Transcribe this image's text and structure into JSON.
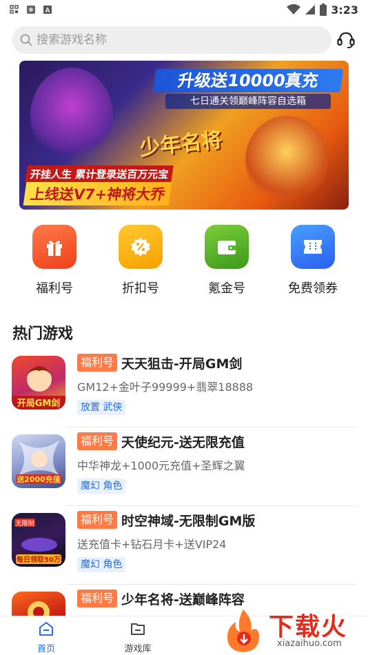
{
  "status_bar": {
    "time": "3:23"
  },
  "search": {
    "placeholder": "搜索游戏名称"
  },
  "banner": {
    "headline": "升级送10000真充",
    "subline": "七日通关领巅峰阵容自选箱",
    "logo_text": "少年名将",
    "line1": "开挂人生  累计登录送百万元宝",
    "line2": "上线送V7+神将大乔"
  },
  "quick_entries": [
    {
      "label": "福利号",
      "icon": "gift-icon",
      "color_from": "#ff7a4a",
      "color_to": "#f0401a"
    },
    {
      "label": "折扣号",
      "icon": "discount-icon",
      "color_from": "#ffc830",
      "color_to": "#f7a000"
    },
    {
      "label": "氪金号",
      "icon": "wallet-icon",
      "color_from": "#7ccd3a",
      "color_to": "#3a9a1a"
    },
    {
      "label": "免费领券",
      "icon": "coupon-icon",
      "color_from": "#4aa0ff",
      "color_to": "#2a5ef0"
    }
  ],
  "section": {
    "hot_games_title": "热门游戏"
  },
  "games": [
    {
      "tag": "福利号",
      "name": "天天狙击-开局GM剑",
      "desc": "GM12+金叶子99999+翡翠18888",
      "category": "放置 武侠"
    },
    {
      "tag": "福利号",
      "name": "天使纪元-送无限充值",
      "desc": "中华神龙+1000元充值+圣辉之翼",
      "category": "魔幻 角色"
    },
    {
      "tag": "福利号",
      "name": "时空神域-无限制GM版",
      "desc": "送充值卡+钻石月卡+送VIP24",
      "category": "魔幻 角色"
    },
    {
      "tag": "福利号",
      "name": "少年名将-送巅峰阵容",
      "desc": "",
      "category": ""
    }
  ],
  "bottom_nav": [
    {
      "label": "首页",
      "icon": "home-icon",
      "active": true
    },
    {
      "label": "游戏库",
      "icon": "folder-icon",
      "active": false
    }
  ],
  "watermark": {
    "brand": "下载火",
    "url": "xiazaihuo.com"
  },
  "colors": {
    "accent_blue": "#2a6cd6",
    "welfare_tag": "#ff7a45",
    "watermark_red": "#e52a1a"
  }
}
